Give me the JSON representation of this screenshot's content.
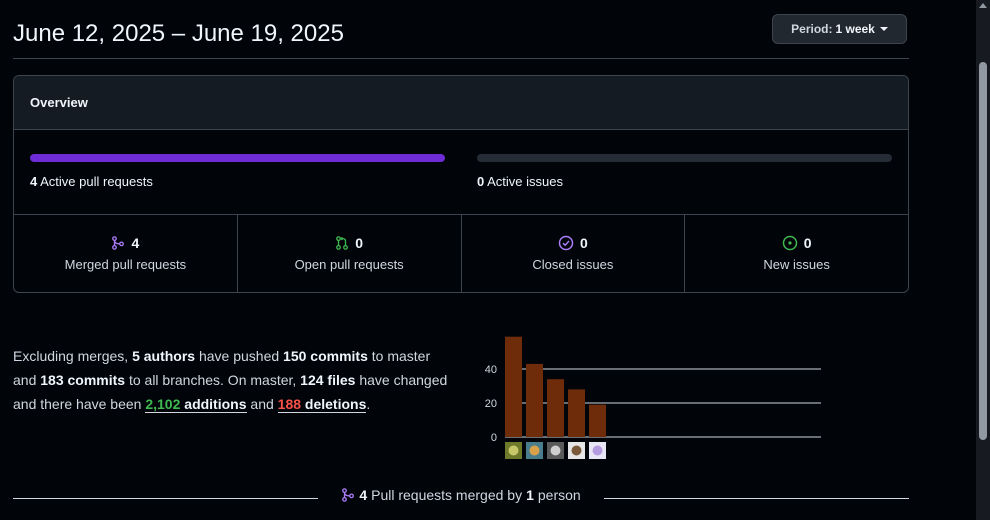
{
  "header": {
    "date_range": "June 12, 2025 – June 19, 2025",
    "period_prefix": "Period:",
    "period_value": "1 week"
  },
  "overview": {
    "title": "Overview",
    "active_prs": {
      "count": "4",
      "label": "Active pull requests",
      "fill_fraction": 1.0,
      "color": "#6e2cd6"
    },
    "active_issues": {
      "count": "0",
      "label": "Active issues",
      "fill_fraction": 0.0
    },
    "stats": [
      {
        "icon": "merge-icon",
        "count": "4",
        "label": "Merged pull requests",
        "color": "#ab7df8"
      },
      {
        "icon": "pull-request-open-icon",
        "count": "0",
        "label": "Open pull requests",
        "color": "#3fb950"
      },
      {
        "icon": "issue-closed-icon",
        "count": "0",
        "label": "Closed issues",
        "color": "#ab7df8"
      },
      {
        "icon": "issue-opened-icon",
        "count": "0",
        "label": "New issues",
        "color": "#3fb950"
      }
    ]
  },
  "summary": {
    "t1": "Excluding merges, ",
    "authors": "5 authors",
    "t2": " have pushed ",
    "commits_master": "150 commits",
    "t3": " to master and ",
    "commits_all": "183 commits",
    "t4": " to all branches. On master, ",
    "files": "124 files",
    "t5": " have changed and there have been ",
    "additions_num": "2,102",
    "additions_word": " additions",
    "t6": " and ",
    "deletions_num": "188",
    "deletions_word": " deletions",
    "t7": "."
  },
  "chart_data": {
    "type": "bar",
    "categories": [
      "author-1",
      "author-2",
      "author-3",
      "author-4",
      "author-5"
    ],
    "values": [
      59,
      43,
      34,
      28,
      19
    ],
    "yticks": [
      "0",
      "20",
      "40"
    ],
    "ylim": [
      0,
      60
    ],
    "bar_color": "#6e2c0b",
    "grid": true
  },
  "merged_section": {
    "count": "4",
    "text1": " Pull requests merged by ",
    "people": "1",
    "text2": " person"
  }
}
